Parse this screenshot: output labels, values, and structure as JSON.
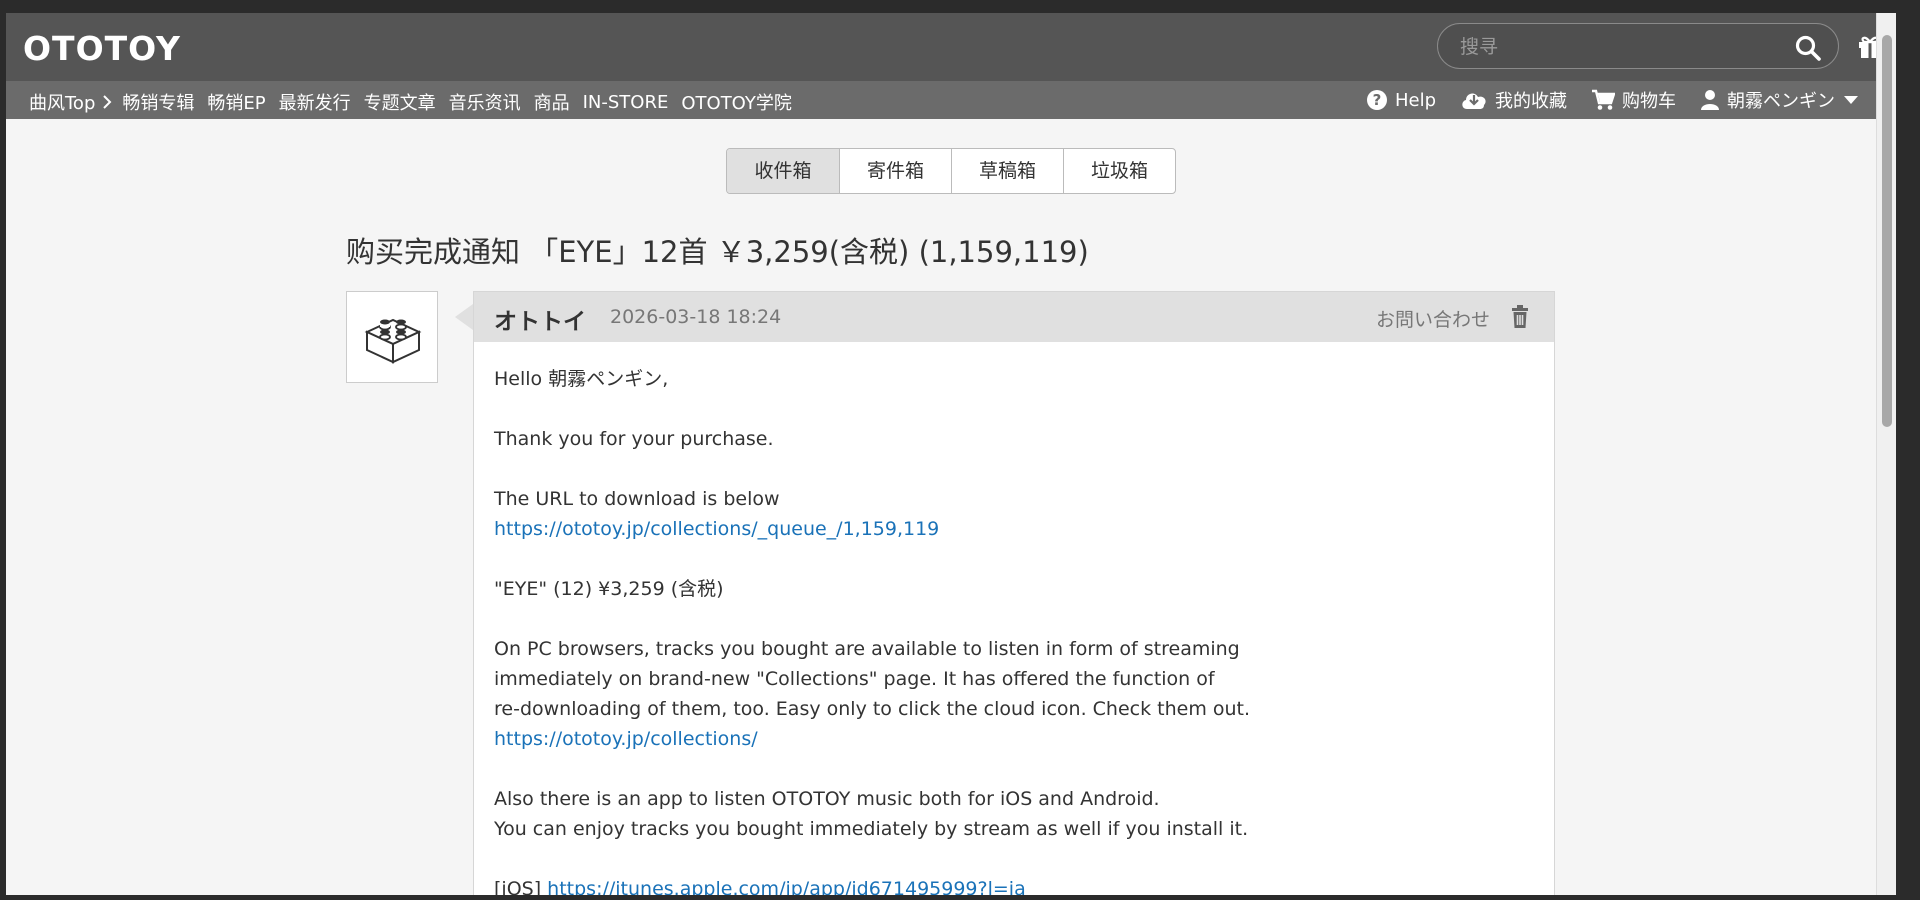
{
  "header": {
    "logo": "OTOTOY",
    "search_placeholder": "搜寻"
  },
  "nav": {
    "items": [
      "曲风Top",
      "畅销专辑",
      "畅销EP",
      "最新发行",
      "专题文章",
      "音乐资讯",
      "商品",
      "IN-STORE",
      "OTOTOY学院"
    ],
    "help": "Help",
    "collection": "我的收藏",
    "cart": "购物车",
    "user": "朝霧ペンギン"
  },
  "tabs": [
    "收件箱",
    "寄件箱",
    "草稿箱",
    "垃圾箱"
  ],
  "message": {
    "title": "购买完成通知 「EYE」12首 ￥3,259(含税) (1,159,119)",
    "sender": "オトトイ",
    "date": "2026-03-18 18:24",
    "contact": "お問い合わせ",
    "greeting": "Hello 朝霧ペンギン,",
    "thanks": "Thank you for your purchase.",
    "url_intro": "The URL to download is below",
    "url_download": "https://ototoy.jp/collections/_queue_/1,159,119",
    "item_line": "\"EYE\" (12) ¥3,259 (含税)",
    "pc_line1": "On PC browsers, tracks you bought are available to listen in form of streaming",
    "pc_line2": "immediately on brand-new \"Collections\" page. It has offered the function of",
    "pc_line3": "re-downloading of them, too. Easy only to click the cloud icon. Check them out.",
    "url_collections": "https://ototoy.jp/collections/",
    "app_line1": "Also there is an app to listen OTOTOY music both for iOS and Android.",
    "app_line2": "You can enjoy tracks you bought immediately by stream as well if you install it.",
    "ios_label": "[iOS]",
    "ios_url": "https://itunes.apple.com/jp/app/id671495999?l=ja"
  }
}
